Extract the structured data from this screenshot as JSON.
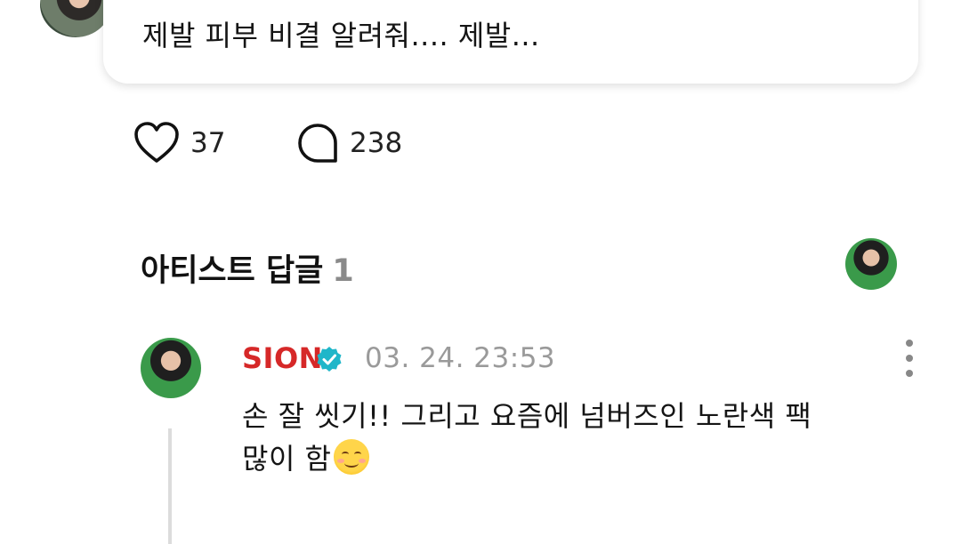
{
  "post": {
    "text": "제발 피부 비결 알려줘.... 제발...",
    "likes": "37",
    "replies": "238"
  },
  "artist_replies": {
    "title": "아티스트 답글",
    "count": "1"
  },
  "comment": {
    "author": "SION",
    "timestamp": "03. 24. 23:53",
    "text_line1": "손 잘 씻기!! 그리고 요즘에 넘버즈인 노란색 팩",
    "text_line2": "많이 함",
    "emoji": "smiling-face-emoji"
  },
  "colors": {
    "author": "#d62828",
    "verified": "#1fb6c9",
    "muted": "#9a9a9a"
  }
}
